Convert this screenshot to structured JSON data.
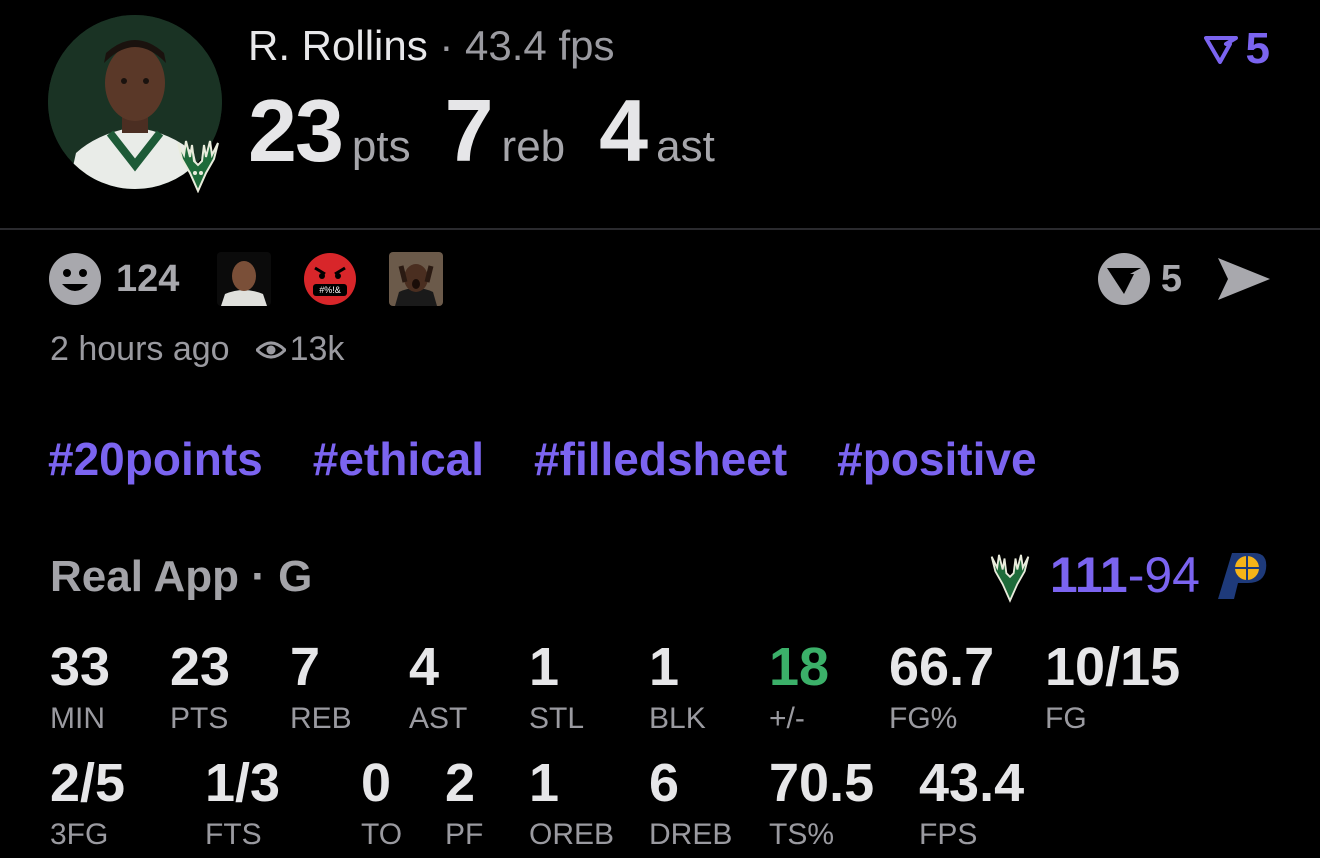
{
  "header": {
    "player_name": "R. Rollins",
    "separator": " · ",
    "fps_text": "43.4 fps",
    "top_count": "5",
    "stats": [
      {
        "value": "23",
        "unit": "pts"
      },
      {
        "value": "7",
        "unit": "reb"
      },
      {
        "value": "4",
        "unit": "ast"
      }
    ]
  },
  "reactions": {
    "count": "124",
    "thumbs": [
      "player-face-reaction",
      "angry-emoji-reaction",
      "shocked-person-reaction"
    ],
    "share_count": "5",
    "angry_text": "#%!&"
  },
  "meta": {
    "time": "2 hours ago",
    "views": "13k"
  },
  "tags": [
    "#20points",
    "#ethical",
    "#filledsheet",
    "#positive"
  ],
  "game": {
    "source": "Real App · G",
    "home_score": "111",
    "dash": "-",
    "away_score": "94"
  },
  "box": {
    "row1": [
      {
        "value": "33",
        "label": "MIN"
      },
      {
        "value": "23",
        "label": "PTS"
      },
      {
        "value": "7",
        "label": "REB"
      },
      {
        "value": "4",
        "label": "AST"
      },
      {
        "value": "1",
        "label": "STL"
      },
      {
        "value": "1",
        "label": "BLK"
      },
      {
        "value": "18",
        "label": "+/-"
      },
      {
        "value": "66.7",
        "label": "FG%"
      },
      {
        "value": "10/15",
        "label": "FG"
      }
    ],
    "row2": [
      {
        "value": "2/5",
        "label": "3FG"
      },
      {
        "value": "1/3",
        "label": "FTS"
      },
      {
        "value": "0",
        "label": "TO"
      },
      {
        "value": "2",
        "label": "PF"
      },
      {
        "value": "1",
        "label": "OREB"
      },
      {
        "value": "6",
        "label": "DREB"
      },
      {
        "value": "70.5",
        "label": "TS%"
      },
      {
        "value": "43.4",
        "label": "FPS"
      }
    ]
  },
  "colors": {
    "accent": "#7b64f0",
    "positive": "#3bb069",
    "background": "#000000"
  }
}
